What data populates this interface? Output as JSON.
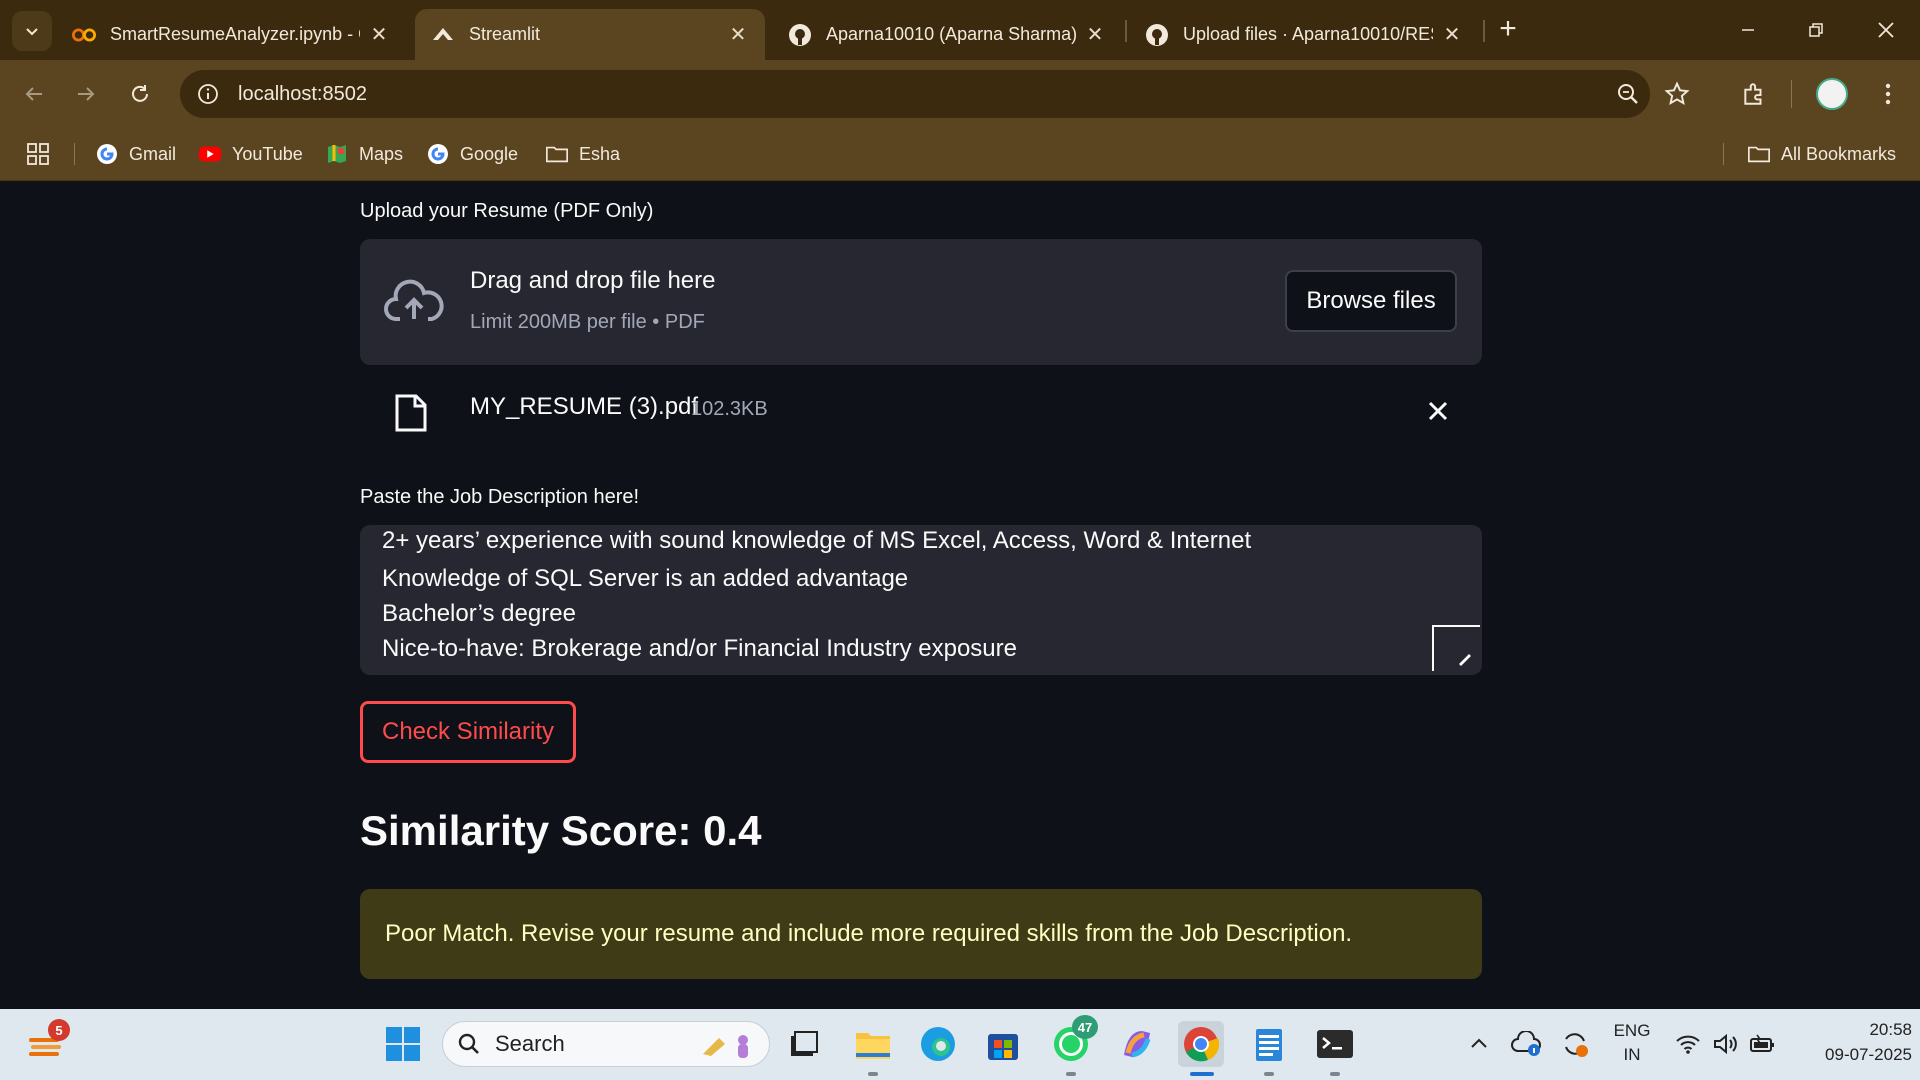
{
  "browser": {
    "tabs": [
      {
        "title": "SmartResumeAnalyzer.ipynb - C",
        "icon": "colab-icon"
      },
      {
        "title": "Streamlit",
        "icon": "streamlit-icon"
      },
      {
        "title": "Aparna10010 (Aparna Sharma)",
        "icon": "github-icon"
      },
      {
        "title": "Upload files · Aparna10010/RES",
        "icon": "github-icon"
      }
    ],
    "new_tab": "+",
    "url": "localhost:8502",
    "bookmarks": [
      {
        "label": "Gmail",
        "icon": "google-icon"
      },
      {
        "label": "YouTube",
        "icon": "youtube-icon"
      },
      {
        "label": "Maps",
        "icon": "maps-icon"
      },
      {
        "label": "Google",
        "icon": "google-icon"
      },
      {
        "label": "Esha",
        "icon": "folder-icon"
      }
    ],
    "all_bookmarks": "All Bookmarks"
  },
  "app": {
    "upload_label": "Upload your Resume (PDF Only)",
    "dropzone_title": "Drag and drop file here",
    "dropzone_sub": "Limit 200MB per file • PDF",
    "browse_label": "Browse files",
    "file_name": "MY_RESUME (3).pdf",
    "file_size": "102.3KB",
    "jd_label": "Paste the Job Description here!",
    "jd_lines": [
      "2+ years’ experience with sound knowledge of MS Excel, Access, Word & Internet",
      "Knowledge of SQL Server is an added advantage",
      "Bachelor’s degree",
      "Nice-to-have: Brokerage and/or Financial Industry exposure"
    ],
    "check_label": "Check Similarity",
    "score_text": "Similarity Score: 0.4",
    "alert_text": "Poor Match. Revise your resume and include more required skills from the Job Description."
  },
  "taskbar": {
    "weather_badge": "5",
    "search_placeholder": "Search",
    "whatsapp_badge": "47",
    "lang_top": "ENG",
    "lang_bottom": "IN",
    "time": "20:58",
    "date": "09-07-2025"
  },
  "colors": {
    "streamlit_red": "#ff4b4b",
    "alert_bg": "#3e3b16",
    "chrome_brown": "#5a4520"
  }
}
